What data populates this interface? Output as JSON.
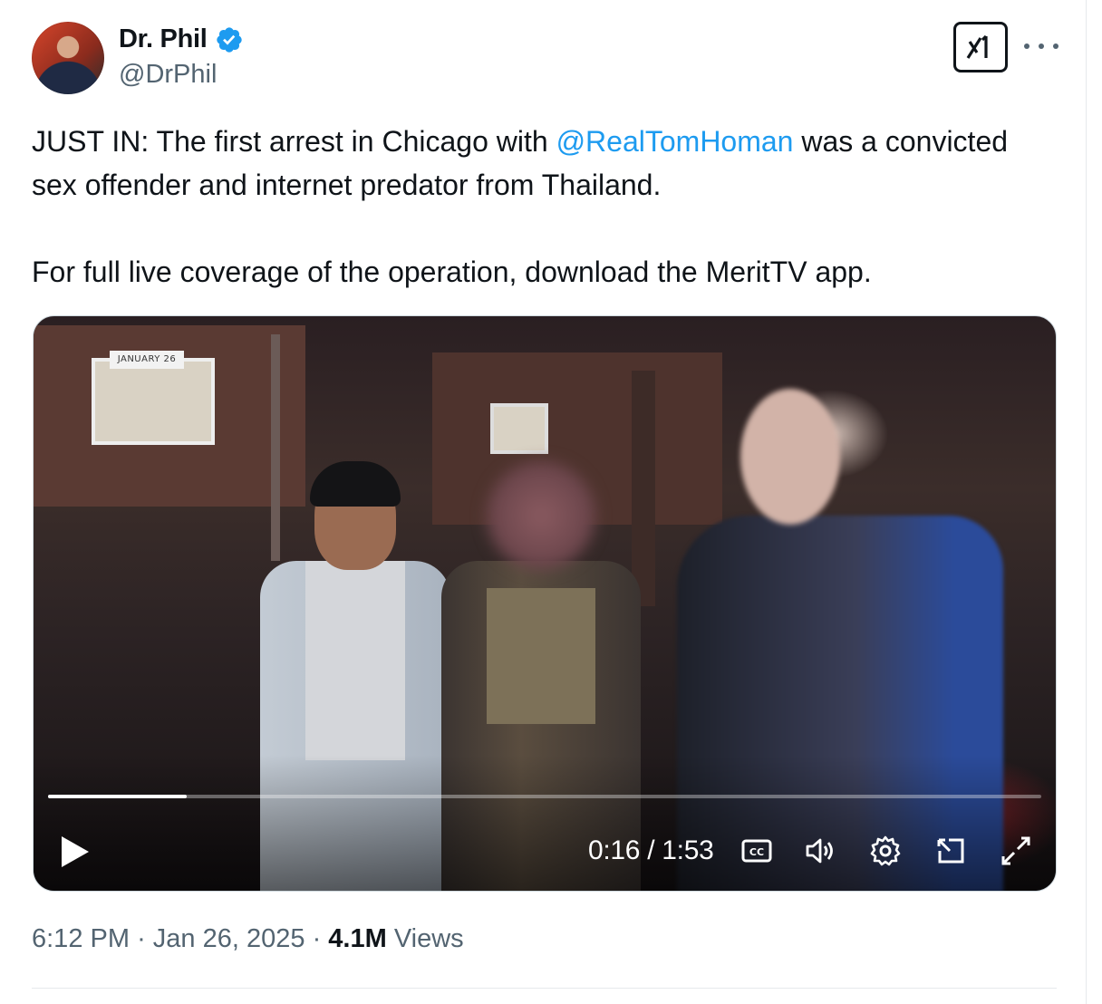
{
  "author": {
    "name": "Dr. Phil",
    "handle": "@DrPhil",
    "verified": true,
    "verified_color": "#1d9bf0"
  },
  "header_icons": [
    "grok-icon",
    "more-icon"
  ],
  "tweet": {
    "line1_prefix": "JUST IN: The first arrest in Chicago with ",
    "mention": "@RealTomHoman",
    "line1_suffix": " was a convicted sex offender and internet predator from Thailand.",
    "paragraph2": "For full live coverage of the operation, download the MeritTV app."
  },
  "video": {
    "overlay_date": "JANUARY 26",
    "current_time": "0:16",
    "duration": "1:53",
    "time_display": "0:16 / 1:53",
    "progress_fraction": 0.14,
    "controls": [
      "play-icon",
      "captions-icon",
      "volume-icon",
      "settings-icon",
      "pip-icon",
      "fullscreen-icon"
    ]
  },
  "meta": {
    "time": "6:12 PM",
    "separator": "·",
    "date": "Jan 26, 2025",
    "views_count": "4.1M",
    "views_label": "Views"
  },
  "colors": {
    "text": "#0f1419",
    "secondary": "#536471",
    "link": "#1d9bf0"
  }
}
